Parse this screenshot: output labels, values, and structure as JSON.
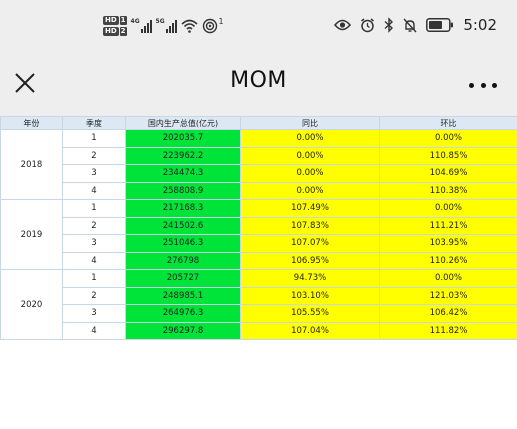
{
  "status_bar": {
    "sim1_label": "HD",
    "sim1_num": "1",
    "sim2_label": "HD",
    "sim2_num": "2",
    "net1": "4G",
    "net2": "5G",
    "hotspot_count": "1",
    "time": "5:02",
    "icons": [
      "eye-icon",
      "alarm-icon",
      "bluetooth-icon",
      "mute-icon",
      "battery-icon"
    ]
  },
  "title_bar": {
    "title": "MOM",
    "close_icon": "close-icon",
    "more_icon": "more-icon"
  },
  "table": {
    "headers": {
      "year": "年份",
      "quarter": "季度",
      "gdp": "国内生产总值(亿元)",
      "yoy": "同比",
      "qoq": "环比"
    },
    "groups": [
      {
        "year": "2018",
        "rows": [
          {
            "q": "1",
            "gdp": "202035.7",
            "yoy": "0.00%",
            "qoq": "0.00%"
          },
          {
            "q": "2",
            "gdp": "223962.2",
            "yoy": "0.00%",
            "qoq": "110.85%"
          },
          {
            "q": "3",
            "gdp": "234474.3",
            "yoy": "0.00%",
            "qoq": "104.69%"
          },
          {
            "q": "4",
            "gdp": "258808.9",
            "yoy": "0.00%",
            "qoq": "110.38%"
          }
        ]
      },
      {
        "year": "2019",
        "rows": [
          {
            "q": "1",
            "gdp": "217168.3",
            "yoy": "107.49%",
            "qoq": "0.00%"
          },
          {
            "q": "2",
            "gdp": "241502.6",
            "yoy": "107.83%",
            "qoq": "111.21%"
          },
          {
            "q": "3",
            "gdp": "251046.3",
            "yoy": "107.07%",
            "qoq": "103.95%"
          },
          {
            "q": "4",
            "gdp": "276798",
            "yoy": "106.95%",
            "qoq": "110.26%"
          }
        ]
      },
      {
        "year": "2020",
        "rows": [
          {
            "q": "1",
            "gdp": "205727",
            "yoy": "94.73%",
            "qoq": "0.00%"
          },
          {
            "q": "2",
            "gdp": "248985.1",
            "yoy": "103.10%",
            "qoq": "121.03%"
          },
          {
            "q": "3",
            "gdp": "264976.3",
            "yoy": "105.55%",
            "qoq": "106.42%"
          },
          {
            "q": "4",
            "gdp": "296297.8",
            "yoy": "107.04%",
            "qoq": "111.82%"
          }
        ]
      }
    ]
  },
  "colors": {
    "header_bg": "#dde8f5",
    "gdp_cell": "#00e43a",
    "ratio_cell": "#ffff00",
    "bar_bg": "#eeeeee",
    "border": "#c9d6e6"
  }
}
